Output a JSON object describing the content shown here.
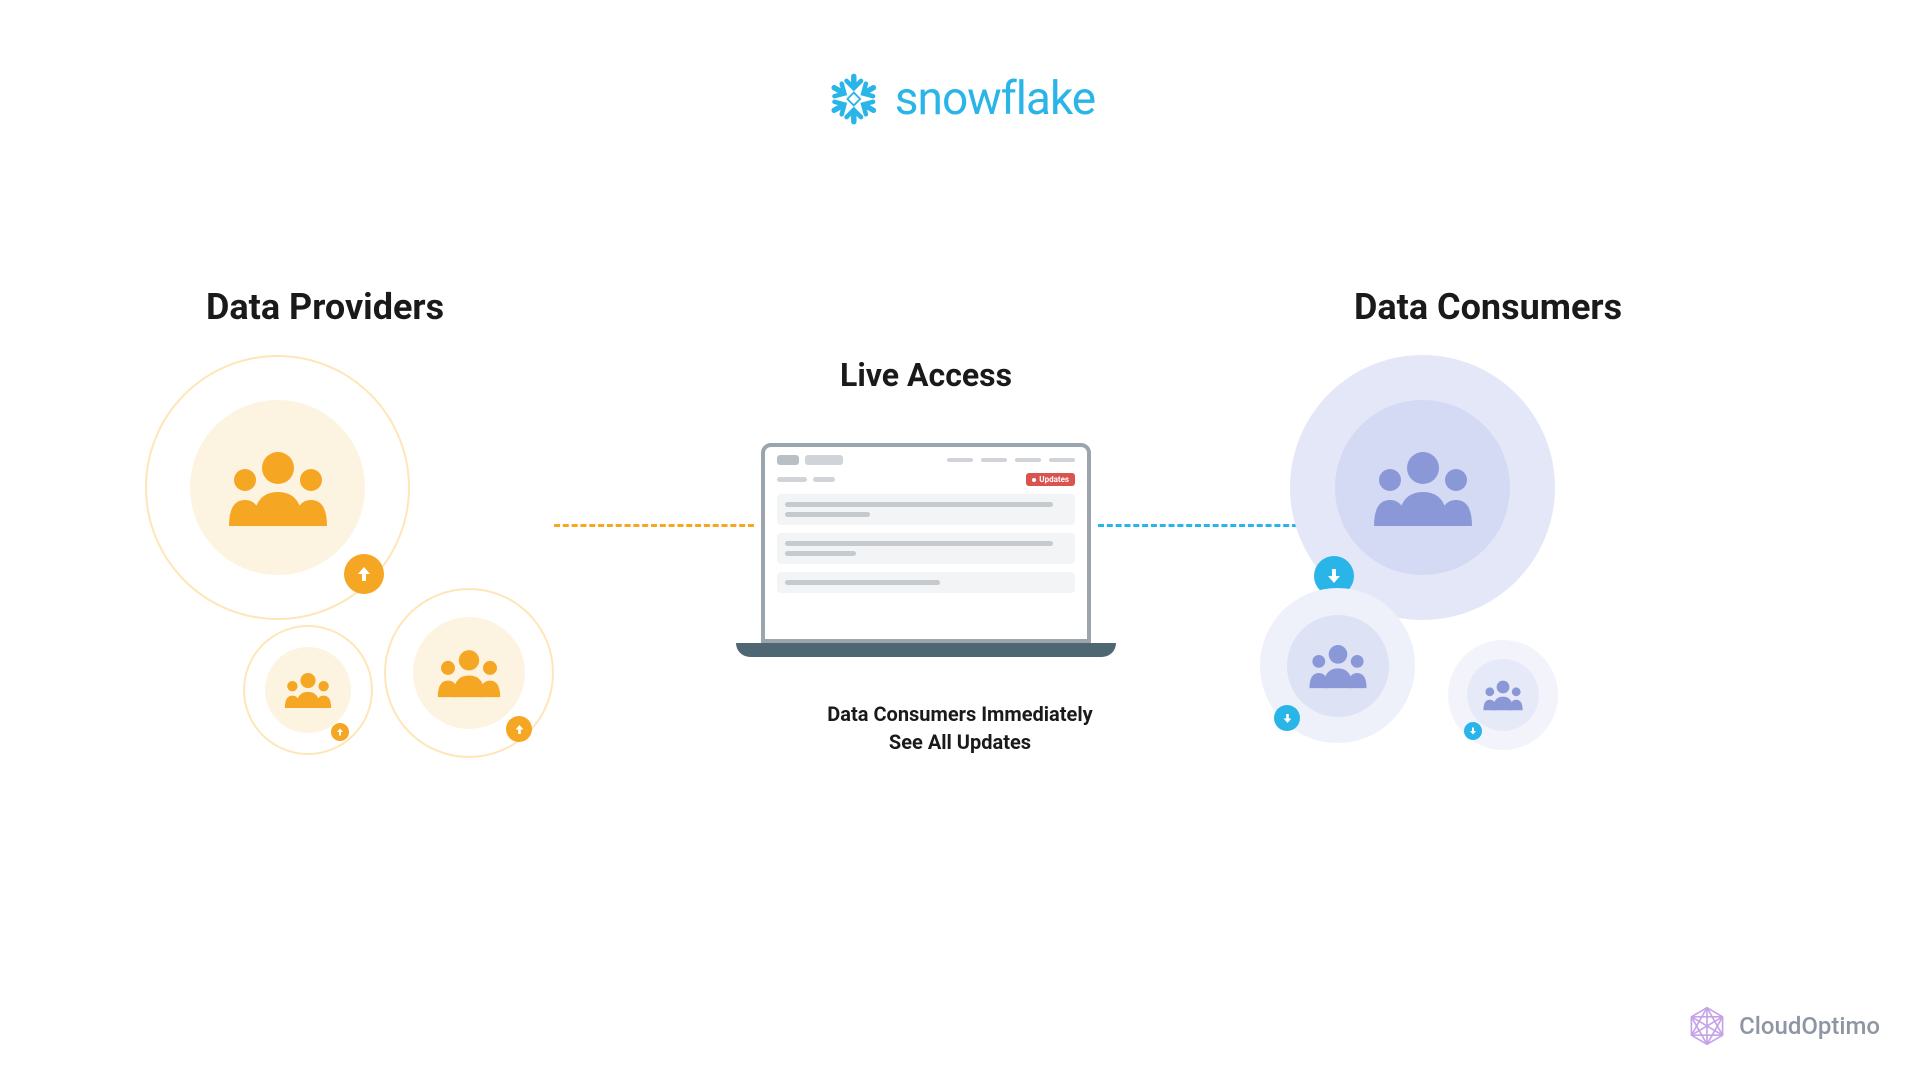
{
  "logo": {
    "brand": "snowflake"
  },
  "titles": {
    "providers": "Data Providers",
    "consumers": "Data Consumers",
    "live_access": "Live Access"
  },
  "laptop": {
    "updates_label": "Updates"
  },
  "caption_line1": "Data Consumers Immediately",
  "caption_line2": "See All Updates",
  "footer": {
    "brand": "CloudOptimo"
  },
  "colors": {
    "provider_icon": "#f5a623",
    "consumer_icon": "#8a98d8",
    "provider_badge": "#f5a623",
    "consumer_badge": "#29b5e8",
    "snowflake": "#29b5e8"
  },
  "icons": {
    "provider_badge_direction": "up",
    "consumer_badge_direction": "down"
  }
}
